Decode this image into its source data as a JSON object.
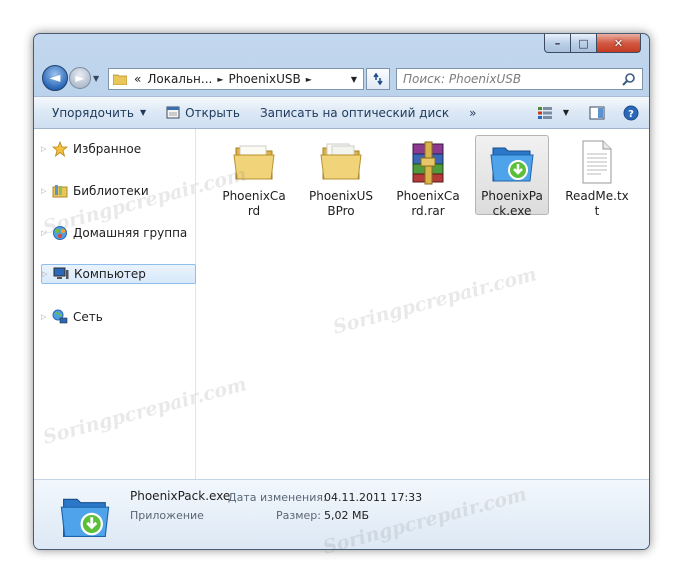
{
  "window": {
    "caption_buttons": {
      "minimize": "–",
      "maximize": "□",
      "close": "✕"
    }
  },
  "address": {
    "crumbs": [
      "«",
      "Локальн...",
      "PhoenixUSB"
    ],
    "separator": "►"
  },
  "search": {
    "placeholder": "Поиск: PhoenixUSB"
  },
  "toolbar": {
    "organize": "Упорядочить",
    "open": "Открыть",
    "burn": "Записать на оптический диск",
    "more": "»"
  },
  "nav": {
    "items": [
      {
        "label": "Избранное",
        "icon": "star-icon"
      },
      {
        "label": "Библиотеки",
        "icon": "libraries-icon"
      },
      {
        "label": "Домашняя группа",
        "icon": "homegroup-icon"
      },
      {
        "label": "Компьютер",
        "icon": "computer-icon",
        "selected": true
      },
      {
        "label": "Сеть",
        "icon": "network-icon"
      }
    ]
  },
  "files": [
    {
      "label": "PhoenixCard",
      "type": "folder"
    },
    {
      "label": "PhoenixUSBPro",
      "type": "folder"
    },
    {
      "label": "PhoenixCard.rar",
      "type": "rar"
    },
    {
      "label": "PhoenixPack.exe",
      "type": "exe",
      "selected": true
    },
    {
      "label": "ReadMe.txt",
      "type": "txt"
    }
  ],
  "details": {
    "name": "PhoenixPack.exe",
    "modified_label": "Дата изменения:",
    "modified_value": "04.11.2011 17:33",
    "type": "Приложение",
    "size_label": "Размер:",
    "size_value": "5,02 МБ"
  },
  "watermark": "Soringpcrepair.com",
  "colors": {
    "selection_border": "#8dbfef",
    "window_frame": "#a9c5e6",
    "link_text": "#1e395b"
  }
}
